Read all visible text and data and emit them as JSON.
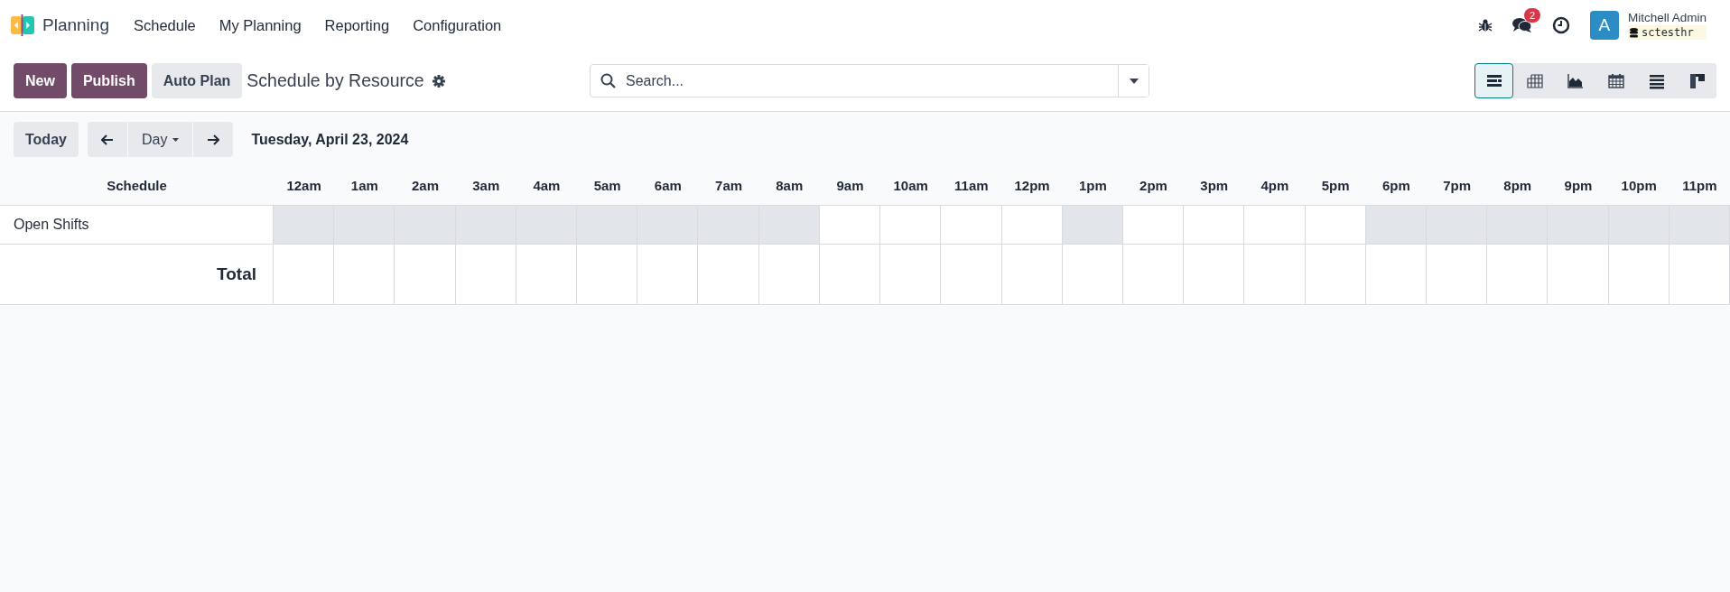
{
  "navbar": {
    "app_name": "Planning",
    "menu": [
      "Schedule",
      "My Planning",
      "Reporting",
      "Configuration"
    ],
    "messages_badge": "2",
    "user": {
      "initial": "A",
      "name": "Mitchell Admin",
      "database": "sctesthr"
    }
  },
  "control_panel": {
    "buttons": [
      {
        "label": "New",
        "kind": "primary"
      },
      {
        "label": "Publish",
        "kind": "primary"
      },
      {
        "label": "Auto Plan",
        "kind": "secondary"
      }
    ],
    "title": "Schedule by Resource",
    "search": {
      "placeholder": "Search..."
    },
    "views": [
      {
        "kind": "gantt",
        "selected": true
      },
      {
        "kind": "pivot",
        "selected": false
      },
      {
        "kind": "graph",
        "selected": false
      },
      {
        "kind": "calendar",
        "selected": false
      },
      {
        "kind": "list",
        "selected": false
      },
      {
        "kind": "kanban",
        "selected": false
      }
    ]
  },
  "toolbar": {
    "today": "Today",
    "scale": "Day",
    "date": "Tuesday, April 23, 2024"
  },
  "gantt": {
    "header": "Schedule",
    "hours": [
      "**12**am",
      "**1**am",
      "**2**am",
      "**3**am",
      "**4**am",
      "**5**am",
      "**6**am",
      "**7**am",
      "**8**am",
      "**9**am",
      "**10**am",
      "**11**am",
      "**12**pm",
      "**1**pm",
      "**2**pm",
      "**3**pm",
      "**4**pm",
      "**5**pm",
      "**6**pm",
      "**7**pm",
      "**8**pm",
      "**9**pm",
      "**10**pm",
      "**11**pm"
    ],
    "rows": [
      {
        "label": "Open Shifts",
        "kind": "resource",
        "unavailable": [
          true,
          true,
          true,
          true,
          true,
          true,
          true,
          true,
          true,
          false,
          false,
          false,
          false,
          true,
          false,
          false,
          false,
          false,
          true,
          true,
          true,
          true,
          true,
          true
        ]
      },
      {
        "label": "Total",
        "kind": "total"
      }
    ]
  }
}
